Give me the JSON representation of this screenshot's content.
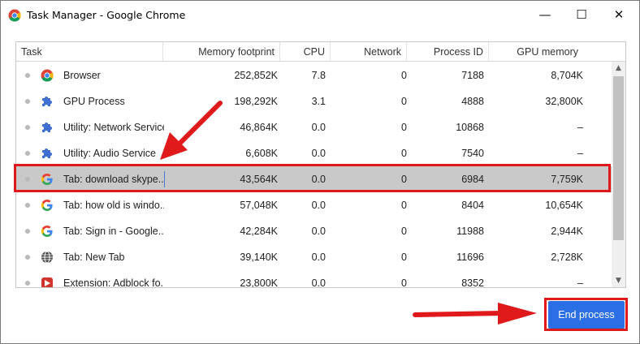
{
  "window": {
    "title": "Task Manager - Google Chrome",
    "minimize_glyph": "—",
    "maximize_glyph": "☐",
    "close_glyph": "✕"
  },
  "columns": {
    "task": "Task",
    "memory": "Memory footprint",
    "cpu": "CPU",
    "network": "Network",
    "pid": "Process ID",
    "gpu": "GPU memory"
  },
  "rows": [
    {
      "icon": "chrome-icon",
      "task": "Browser",
      "memory": "252,852K",
      "cpu": "7.8",
      "network": "0",
      "pid": "7188",
      "gpu": "8,704K"
    },
    {
      "icon": "puzzle-icon",
      "task": "GPU Process",
      "memory": "198,292K",
      "cpu": "3.1",
      "network": "0",
      "pid": "4888",
      "gpu": "32,800K"
    },
    {
      "icon": "puzzle-icon",
      "task": "Utility: Network Service",
      "memory": "46,864K",
      "cpu": "0.0",
      "network": "0",
      "pid": "10868",
      "gpu": "–"
    },
    {
      "icon": "puzzle-icon",
      "task": "Utility: Audio Service",
      "memory": "6,608K",
      "cpu": "0.0",
      "network": "0",
      "pid": "7540",
      "gpu": "–"
    },
    {
      "icon": "google-icon",
      "task": "Tab: download skype...",
      "memory": "43,564K",
      "cpu": "0.0",
      "network": "0",
      "pid": "6984",
      "gpu": "7,759K",
      "selected": true
    },
    {
      "icon": "google-icon",
      "task": "Tab: how old is windo...",
      "memory": "57,048K",
      "cpu": "0.0",
      "network": "0",
      "pid": "8404",
      "gpu": "10,654K"
    },
    {
      "icon": "google-icon",
      "task": "Tab: Sign in - Google...",
      "memory": "42,284K",
      "cpu": "0.0",
      "network": "0",
      "pid": "11988",
      "gpu": "2,944K"
    },
    {
      "icon": "globe-icon",
      "task": "Tab: New Tab",
      "memory": "39,140K",
      "cpu": "0.0",
      "network": "0",
      "pid": "11696",
      "gpu": "2,728K"
    },
    {
      "icon": "adblock-icon",
      "task": "Extension: Adblock fo...",
      "memory": "23,800K",
      "cpu": "0.0",
      "network": "0",
      "pid": "8352",
      "gpu": "–"
    }
  ],
  "scrollbar": {
    "up_glyph": "▲",
    "down_glyph": "▼"
  },
  "end_process_label": "End process",
  "colors": {
    "accent_button": "#2a6fe3",
    "annotation_red": "#e0191b",
    "selected_row": "#c9c9c9"
  }
}
